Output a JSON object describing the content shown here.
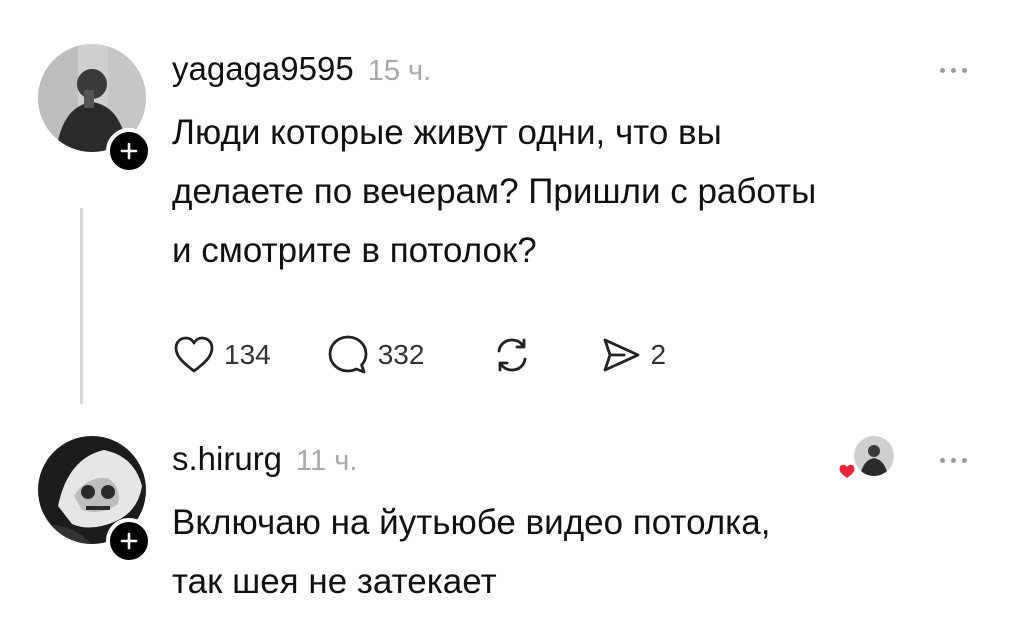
{
  "comments": [
    {
      "username": "yagaga9595",
      "time": "15 ч.",
      "text_lines": [
        "Люди которые живут одни, что вы",
        "делаете по вечерам? Пришли с работы",
        "и смотрите в потолок?"
      ],
      "likes": "134",
      "replies": "332",
      "shares": "2",
      "icons": [
        "heart-icon",
        "comment-icon",
        "repost-icon",
        "send-icon",
        "more-icon",
        "plus-icon"
      ]
    },
    {
      "username": "s.hirurg",
      "time": "11 ч.",
      "text_lines": [
        "Включаю на йутьюбе видео потолка,",
        "так шея не затекает"
      ],
      "icons": [
        "liked-by-author-avatar",
        "heart-badge-icon",
        "more-icon",
        "plus-icon"
      ]
    }
  ],
  "colors": {
    "text": "#111111",
    "muted": "#a8a8a8",
    "heart_badge": "#e8263b"
  }
}
